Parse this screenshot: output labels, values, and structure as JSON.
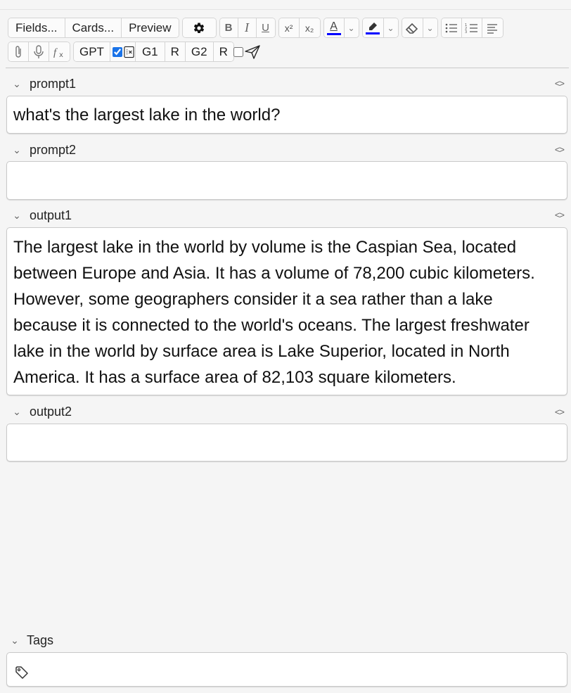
{
  "toolbar": {
    "row1": {
      "fields_label": "Fields...",
      "cards_label": "Cards...",
      "preview_label": "Preview",
      "bold": "B",
      "italic": "I",
      "underline": "U",
      "superscript": "x²",
      "subscript": "x₂",
      "text_color_letter": "A",
      "text_color": "#0000ff",
      "highlight_color": "#0000ff"
    },
    "row2": {
      "gpt_label": "GPT",
      "gpt_checked": true,
      "g1_label": "G1",
      "r1_label": "R",
      "g2_label": "G2",
      "r2_label": "R"
    }
  },
  "fields": [
    {
      "name": "prompt1",
      "value": "what's the largest lake in the world?"
    },
    {
      "name": "prompt2",
      "value": ""
    },
    {
      "name": "output1",
      "value": "The largest lake in the world by volume is the Caspian Sea, located between Europe and Asia. It has a volume of 78,200 cubic kilometers. However, some geographers consider it a sea rather than a lake because it is connected to the world's oceans. The largest freshwater lake in the world by surface area is Lake Superior, located in North America. It has a surface area of 82,103 square kilometers."
    },
    {
      "name": "output2",
      "value": ""
    }
  ],
  "tags": {
    "label": "Tags",
    "value": ""
  },
  "icons": {
    "settings": "gear-icon",
    "attach": "paperclip-icon",
    "record": "microphone-icon",
    "mathjax": "function-icon",
    "tag": "tag-icon",
    "send": "paper-plane-icon"
  }
}
